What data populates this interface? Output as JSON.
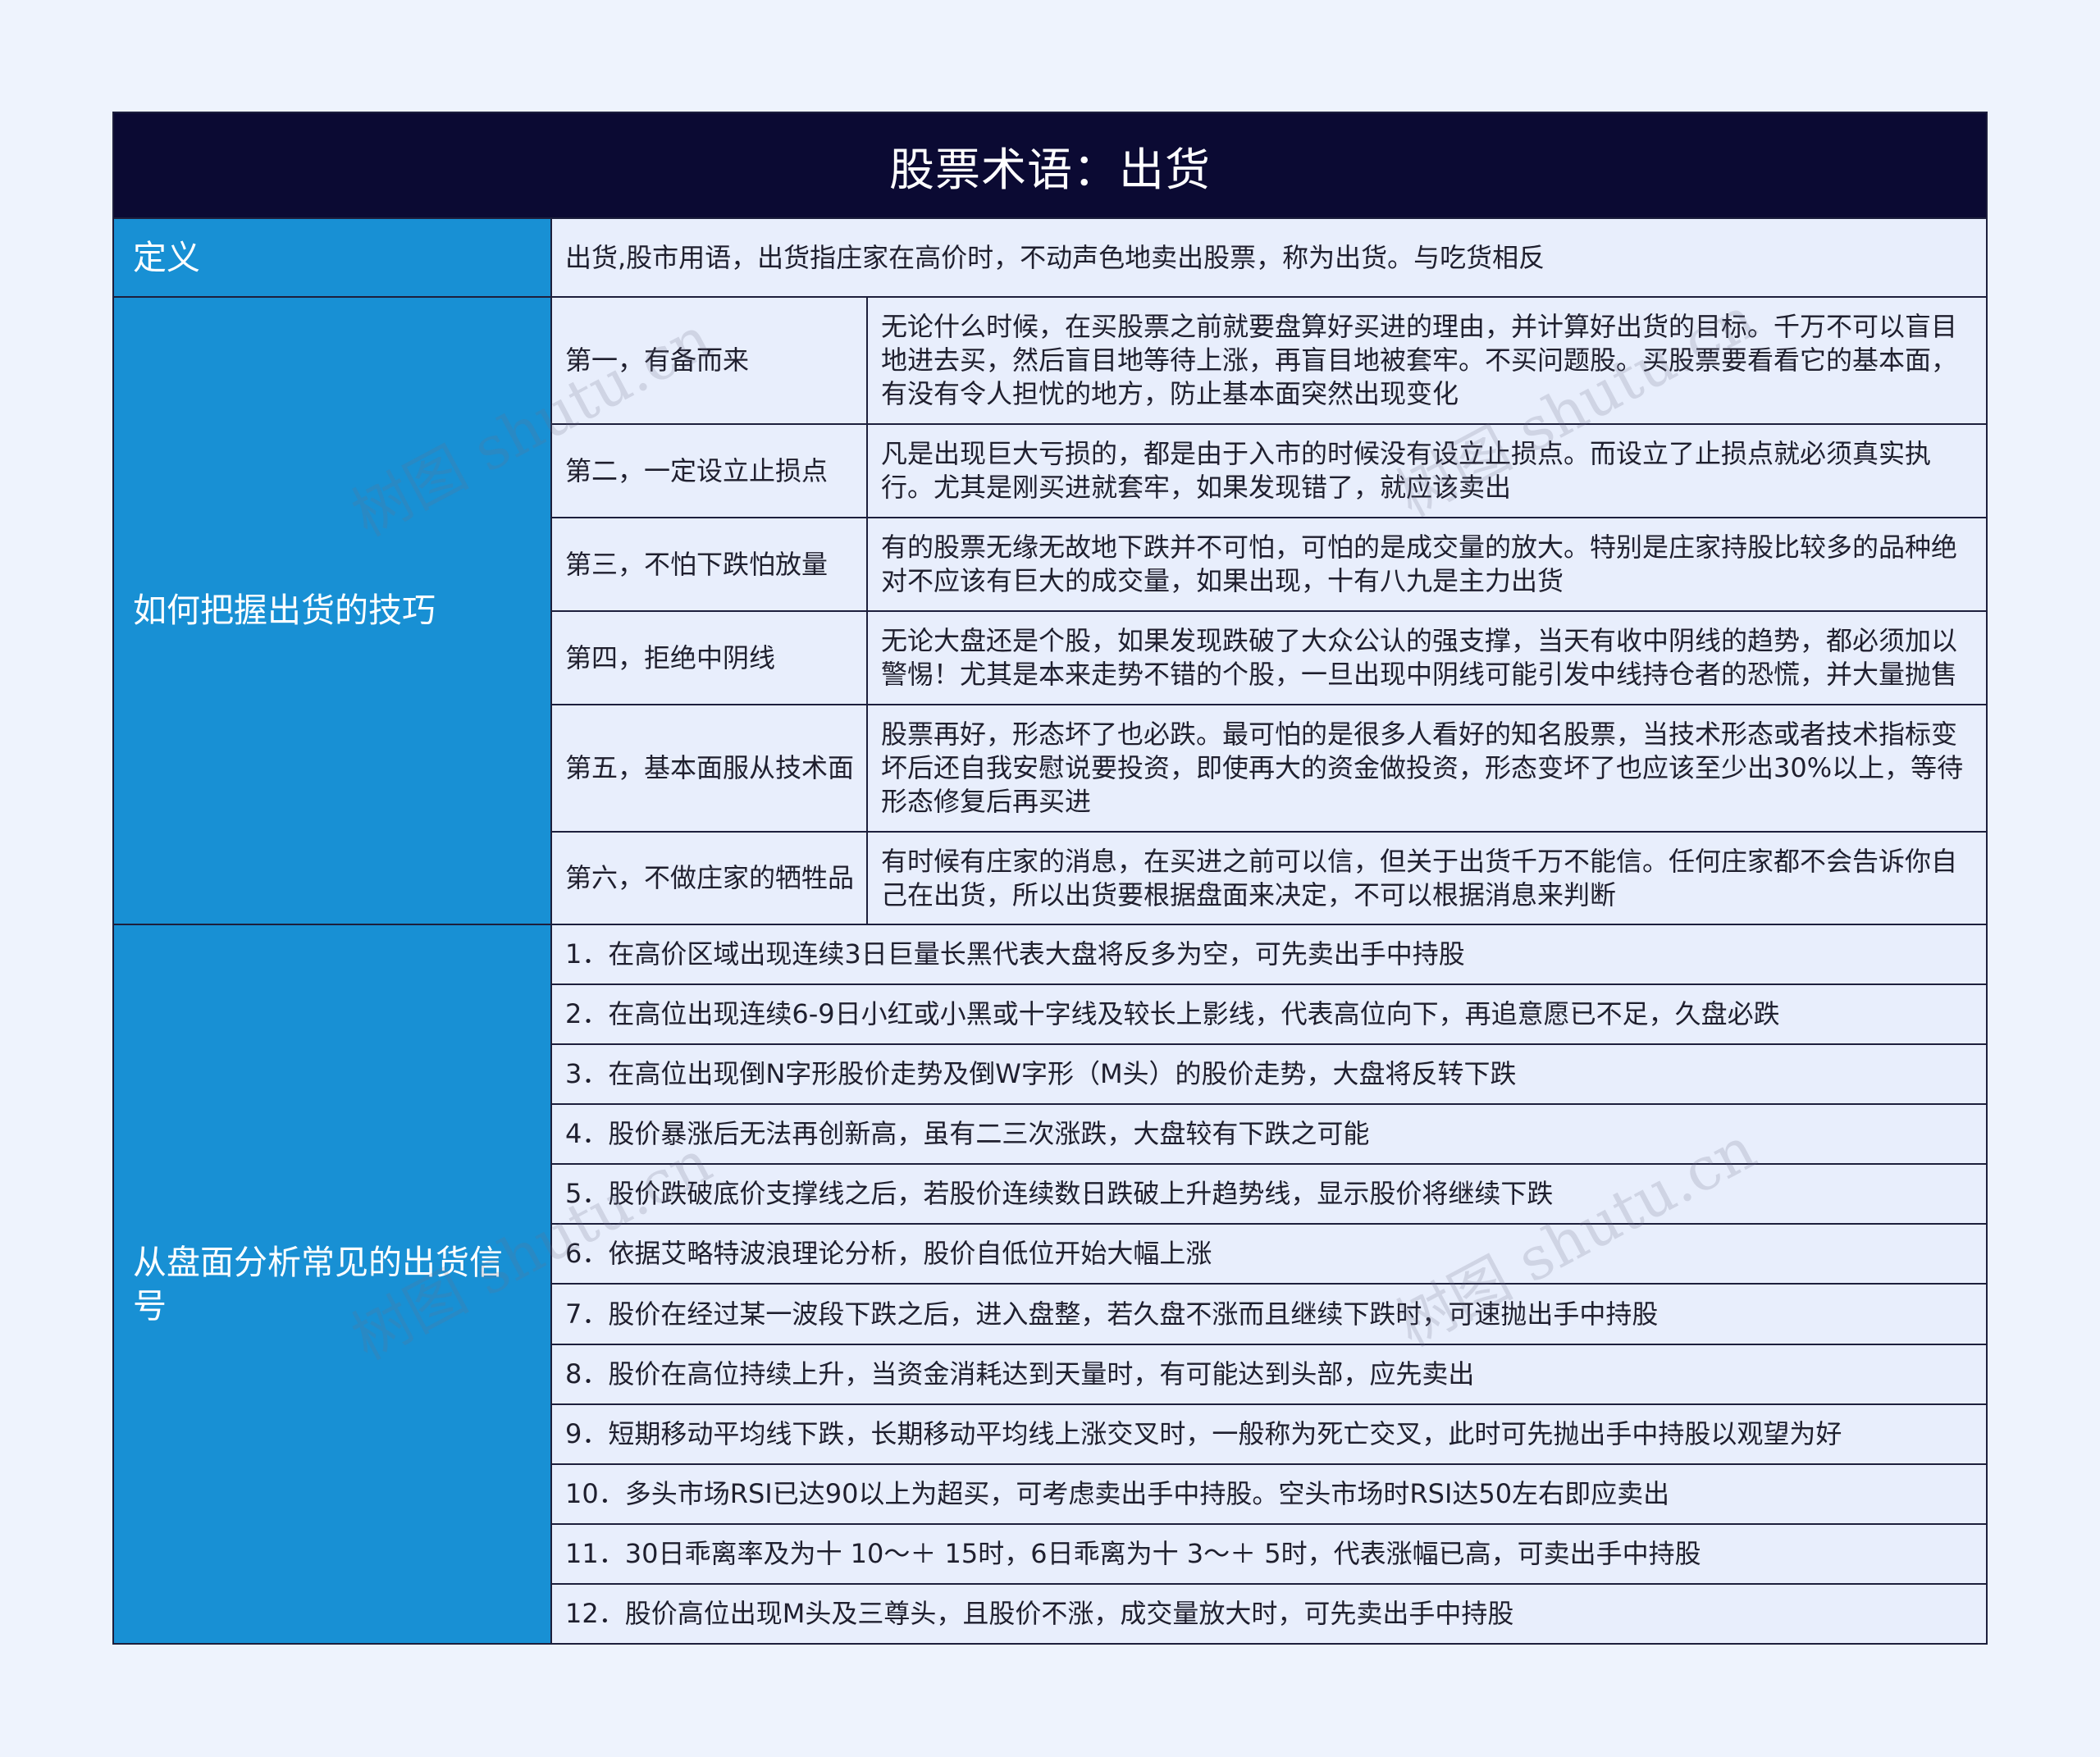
{
  "title": "股票术语：出货",
  "watermark": "树图 shutu.cn",
  "theme": {
    "page_bg": "#eef3fd",
    "title_bg": "#0b0a33",
    "label_bg": "#1890d4",
    "cell_bg": "#e8eefc",
    "border": "#1d1f3c"
  },
  "definition": {
    "label": "定义",
    "text": "出货,股市用语，出货指庄家在高价时，不动声色地卖出股票，称为出货。与吃货相反"
  },
  "tips": {
    "label": "如何把握出货的技巧",
    "items": [
      {
        "title": "第一，有备而来",
        "text": "无论什么时候，在买股票之前就要盘算好买进的理由，并计算好出货的目标。千万不可以盲目地进去买，然后盲目地等待上涨，再盲目地被套牢。不买问题股。买股票要看看它的基本面，有没有令人担忧的地方，防止基本面突然出现变化"
      },
      {
        "title": "第二，一定设立止损点",
        "text": "凡是出现巨大亏损的，都是由于入市的时候没有设立止损点。而设立了止损点就必须真实执行。尤其是刚买进就套牢，如果发现错了，就应该卖出"
      },
      {
        "title": "第三，不怕下跌怕放量",
        "text": "有的股票无缘无故地下跌并不可怕，可怕的是成交量的放大。特别是庄家持股比较多的品种绝对不应该有巨大的成交量，如果出现，十有八九是主力出货"
      },
      {
        "title": "第四，拒绝中阴线",
        "text": "无论大盘还是个股，如果发现跌破了大众公认的强支撑，当天有收中阴线的趋势，都必须加以警惕！尤其是本来走势不错的个股，一旦出现中阴线可能引发中线持仓者的恐慌，并大量抛售"
      },
      {
        "title": "第五，基本面服从技术面",
        "text": "股票再好，形态坏了也必跌。最可怕的是很多人看好的知名股票，当技术形态或者技术指标变坏后还自我安慰说要投资，即使再大的资金做投资，形态变坏了也应该至少出30%以上，等待形态修复后再买进"
      },
      {
        "title": "第六，不做庄家的牺牲品",
        "text": "有时候有庄家的消息，在买进之前可以信，但关于出货千万不能信。任何庄家都不会告诉你自己在出货，所以出货要根据盘面来决定，不可以根据消息来判断"
      }
    ]
  },
  "signals": {
    "label": "从盘面分析常见的出货信号",
    "items": [
      "1．在高价区域出现连续3日巨量长黑代表大盘将反多为空，可先卖出手中持股",
      "2．在高位出现连续6-9日小红或小黑或十字线及较长上影线，代表高位向下，再追意愿已不足，久盘必跌",
      "3．在高位出现倒N字形股价走势及倒W字形（M头）的股价走势，大盘将反转下跌",
      "4．股价暴涨后无法再创新高，虽有二三次涨跌，大盘较有下跌之可能",
      "5．股价跌破底价支撑线之后，若股价连续数日跌破上升趋势线，显示股价将继续下跌",
      "6．依据艾略特波浪理论分析，股价自低位开始大幅上涨",
      "7．股价在经过某一波段下跌之后，进入盘整，若久盘不涨而且继续下跌时，可速抛出手中持股",
      "8．股价在高位持续上升，当资金消耗达到天量时，有可能达到头部，应先卖出",
      "9．短期移动平均线下跌，长期移动平均线上涨交叉时，一般称为死亡交叉，此时可先抛出手中持股以观望为好",
      "10．多头市场RSI已达90以上为超买，可考虑卖出手中持股。空头市场时RSI达50左右即应卖出",
      "11．30日乖离率及为十 10～＋ 15时，6日乖离为十 3～＋ 5时，代表涨幅已高，可卖出手中持股",
      "12．股价高位出现M头及三尊头，且股价不涨，成交量放大时，可先卖出手中持股"
    ]
  }
}
